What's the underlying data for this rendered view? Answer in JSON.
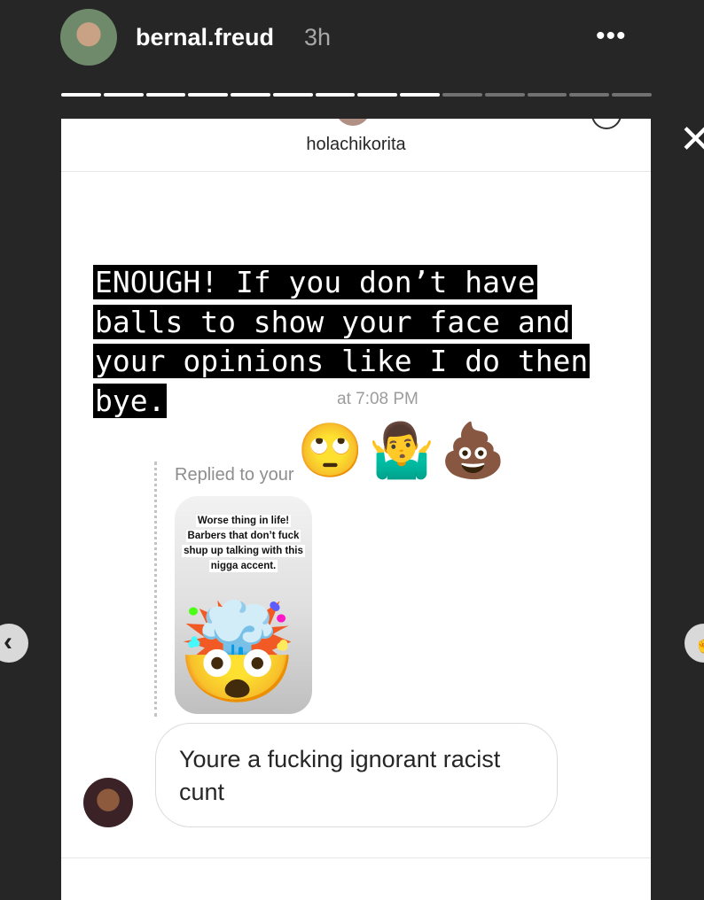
{
  "story": {
    "username": "bernal.freud",
    "time": "3h",
    "more_icon": "•••",
    "close_icon": "✕",
    "progress": {
      "total": 14,
      "current": 9
    }
  },
  "nav": {
    "prev_icon": "‹",
    "next_icon": "☝"
  },
  "dm": {
    "name": "holachikorita",
    "overlay_text": "ENOUGH! If you don’t have balls to show your face and your opinions like I do then bye.",
    "timestamp": "at 7:08 PM",
    "emojis": "🙄🤷‍♂️💩",
    "replied_label": "Replied to your",
    "thumb_text": "Worse thing in life! Barbers that don’t fuck shup up talking with this nigga accent.",
    "thumb_emoji": "🤯",
    "message": "Youre a fucking ignorant racist cunt"
  }
}
